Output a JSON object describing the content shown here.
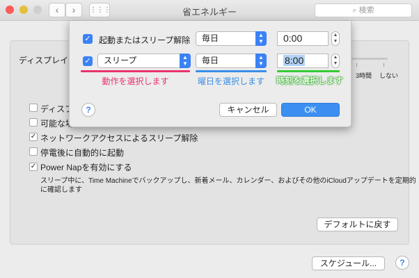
{
  "window": {
    "title": "省エネルギー",
    "search_placeholder": "検索"
  },
  "display_sleep": {
    "label": "ディスプレイを",
    "ticks": [
      "3時間",
      "しない"
    ]
  },
  "options": [
    {
      "label": "ディスプ",
      "checked": false
    },
    {
      "label": "可能な場",
      "checked": false
    },
    {
      "label": "ネットワークアクセスによるスリープ解除",
      "checked": true
    },
    {
      "label": "停電後に自動的に起動",
      "checked": false
    },
    {
      "label": "Power Napを有効にする",
      "checked": true
    }
  ],
  "power_nap_description": [
    "スリープ中に、Time Machineでバックアップし、新着メール、カレンダー、およびその他のiCloudアップデートを定期的",
    "に確認します"
  ],
  "defaults_button": "デフォルトに戻す",
  "schedule_button": "スケジュール...",
  "help": "?",
  "schedule_sheet": {
    "rows": [
      {
        "checked": true,
        "action": "起動またはスリープ解除",
        "day": "毎日",
        "time": "0:00"
      },
      {
        "checked": true,
        "action": "スリープ",
        "day": "毎日",
        "time": "8:00"
      }
    ],
    "annotations": {
      "action": {
        "text": "動作を選択します",
        "color": "#e8336d"
      },
      "day": {
        "text": "曜日を選択します",
        "color": "#3a8ee6"
      },
      "time": {
        "text": "時刻を選択します",
        "color": "#33cc33"
      }
    },
    "cancel": "キャンセル",
    "ok": "OK"
  }
}
